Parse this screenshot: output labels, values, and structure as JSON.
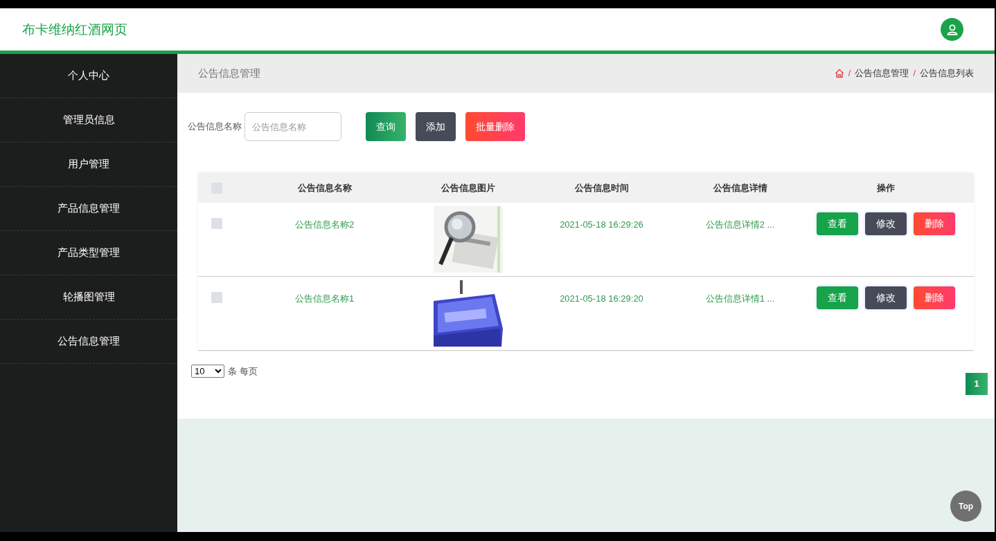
{
  "header": {
    "title": "布卡维纳红酒网页"
  },
  "sidebar": {
    "items": [
      {
        "label": "个人中心"
      },
      {
        "label": "管理员信息"
      },
      {
        "label": "用户管理"
      },
      {
        "label": "产品信息管理"
      },
      {
        "label": "产品类型管理"
      },
      {
        "label": "轮播图管理"
      },
      {
        "label": "公告信息管理"
      }
    ]
  },
  "page_title": "公告信息管理",
  "breadcrumb": [
    {
      "separator": "/",
      "label": "公告信息管理"
    },
    {
      "separator": "/",
      "label": "公告信息列表"
    }
  ],
  "search": {
    "label": "公告信息名称",
    "placeholder": "公告信息名称",
    "buttons": [
      {
        "label": "查询",
        "kind": "primary"
      },
      {
        "label": "添加",
        "kind": "dark"
      },
      {
        "label": "批量删除",
        "kind": "danger"
      }
    ]
  },
  "table": {
    "select_all_checked": false,
    "columns": [
      "公告信息名称",
      "公告信息图片",
      "公告信息时间",
      "公告信息详情",
      "操作"
    ],
    "rows": [
      {
        "checked": false,
        "name": "公告信息名称2",
        "time": "2021-05-18 16:29:26",
        "detail": "公告信息详情2 ...",
        "actions": [
          {
            "label": "查看",
            "kind": "primary"
          },
          {
            "label": "修改",
            "kind": "dark"
          },
          {
            "label": "删除",
            "kind": "danger"
          }
        ]
      },
      {
        "checked": false,
        "name": "公告信息名称1",
        "time": "2021-05-18 16:29:20",
        "detail": "公告信息详情1 ...",
        "actions": [
          {
            "label": "查看",
            "kind": "primary"
          },
          {
            "label": "修改",
            "kind": "dark"
          },
          {
            "label": "删除",
            "kind": "danger"
          }
        ]
      }
    ]
  },
  "pagination": {
    "page_size": "10",
    "page_size_label": "条 每页",
    "pages": [
      {
        "label": "1",
        "selected": true
      }
    ]
  },
  "back_to_top": "Top"
}
